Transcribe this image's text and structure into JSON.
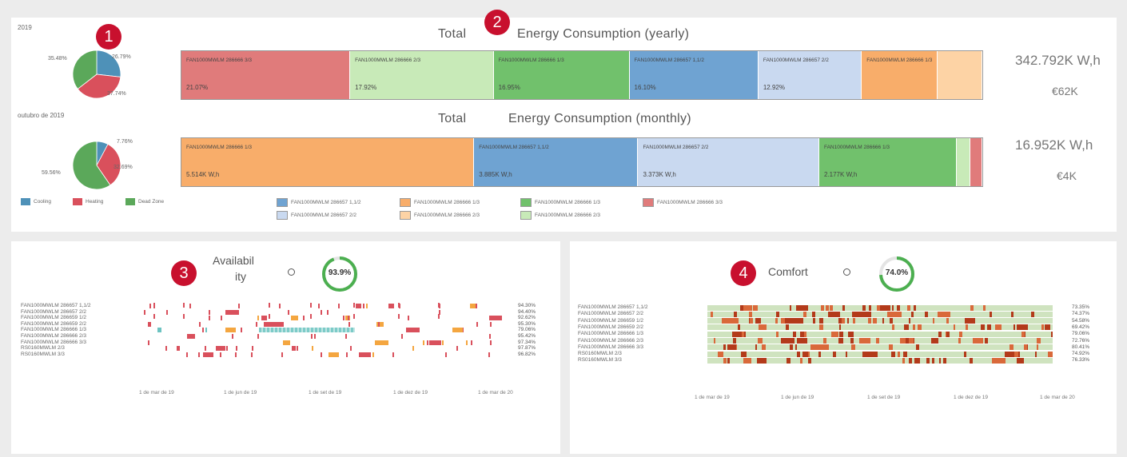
{
  "top": {
    "year_label": "2019",
    "month_label": "outubro de 2019",
    "yearly_title_a": "Total",
    "yearly_title_b": "Energy Consumption (yearly)",
    "monthly_title_a": "Total",
    "monthly_title_b": "Energy Consumption (monthly)",
    "yearly_total": "342.792K W,h",
    "yearly_cost": "€62K",
    "monthly_total": "16.952K W,h",
    "monthly_cost": "€4K",
    "yearly_pie": {
      "labels": [
        "35.48%",
        "26.79%",
        "37.74%"
      ],
      "slices": [
        {
          "name": "Cooling",
          "value": 26.79
        },
        {
          "name": "Heating",
          "value": 37.74
        },
        {
          "name": "Dead Zone",
          "value": 35.48
        }
      ]
    },
    "monthly_pie": {
      "labels": [
        "7.76%",
        "32.69%",
        "59.56%"
      ],
      "slices": [
        {
          "name": "Cooling",
          "value": 7.76
        },
        {
          "name": "Heating",
          "value": 32.69
        },
        {
          "name": "Dead Zone",
          "value": 59.56
        }
      ]
    },
    "yearly_bar": [
      {
        "label": "FAN1000MWLM 286666 3/3",
        "pct": "21.07%",
        "value": 21.07,
        "color": "#e07b7b"
      },
      {
        "label": "FAN1000MWLM 286666 2/3",
        "pct": "17.92%",
        "value": 17.92,
        "color": "#c8eab8"
      },
      {
        "label": "FAN1000MWLM 286666 1/3",
        "pct": "16.95%",
        "value": 16.95,
        "color": "#71c16c"
      },
      {
        "label": "FAN1000MWLM 286657 1,1/2",
        "pct": "16.10%",
        "value": 16.1,
        "color": "#6fa3d2"
      },
      {
        "label": "FAN1000MWLM 286657 2/2",
        "pct": "12.92%",
        "value": 12.92,
        "color": "#c9d9f0"
      },
      {
        "label": "FAN1000MWLM 286666 1/3",
        "pct": "",
        "value": 9.5,
        "color": "#f8ad6a"
      },
      {
        "label": "",
        "pct": "",
        "value": 5.54,
        "color": "#fdd3a5"
      }
    ],
    "monthly_bar": [
      {
        "label": "FAN1000MWLM 286666 1/3",
        "pct": "5.514K W,h",
        "value": 32.5,
        "color": "#f8ad6a"
      },
      {
        "label": "FAN1000MWLM 286657 1,1/2",
        "pct": "3.885K W,h",
        "value": 18.2,
        "color": "#6fa3d2"
      },
      {
        "label": "FAN1000MWLM 286657 2/2",
        "pct": "3.373K W,h",
        "value": 20.1,
        "color": "#c9d9f0"
      },
      {
        "label": "FAN1000MWLM 286666 1/3",
        "pct": "2.177K W,h",
        "value": 15.3,
        "color": "#71c16c"
      },
      {
        "label": "",
        "pct": "",
        "value": 1.5,
        "color": "#c8eab8"
      },
      {
        "label": "",
        "pct": "",
        "value": 1.3,
        "color": "#e07b7b"
      }
    ],
    "pie_legend": [
      {
        "label": "Cooling",
        "color": "#4e91b8"
      },
      {
        "label": "Heating",
        "color": "#d9505c"
      },
      {
        "label": "Dead Zone",
        "color": "#5ba85a"
      }
    ],
    "bar_legend": [
      {
        "label": "FAN1000MWLM 286657 1,1/2",
        "color": "#6fa3d2"
      },
      {
        "label": "FAN1000MWLM 286666 1/3",
        "color": "#f8ad6a"
      },
      {
        "label": "FAN1000MWLM 286666 1/3",
        "color": "#71c16c"
      },
      {
        "label": "FAN1000MWLM 286666 3/3",
        "color": "#e07b7b"
      },
      {
        "label": "FAN1000MWLM 286657 2/2",
        "color": "#c9d9f0"
      },
      {
        "label": "FAN1000MWLM 286666 2/3",
        "color": "#fdd3a5"
      },
      {
        "label": "FAN1000MWLM 286666 2/3",
        "color": "#c8eab8"
      }
    ]
  },
  "badges": [
    "1",
    "2",
    "3",
    "4"
  ],
  "availability": {
    "title_line1": "Availabil",
    "title_line2": "ity",
    "info_icon": "info-icon",
    "gauge_value": "93.9%",
    "gauge_fraction": 0.939,
    "rows": [
      {
        "name": "FAN1000MWLM 286657 1,1/2",
        "value": "94.30%"
      },
      {
        "name": "FAN1000MWLM 286657 2/2",
        "value": "94.40%"
      },
      {
        "name": "FAN1000MWLM 286659 1/2",
        "value": "92.62%"
      },
      {
        "name": "FAN1000MWLM 286659 2/2",
        "value": "95.30%"
      },
      {
        "name": "FAN1000MWLM 286666 1/3",
        "value": "79.06%"
      },
      {
        "name": "FAN1000MWLM 286666 2/3",
        "value": "95.42%"
      },
      {
        "name": "FAN1000MWLM 286666 3/3",
        "value": "97.34%"
      },
      {
        "name": "RS0160MWLM 2/3",
        "value": "97.87%"
      },
      {
        "name": "RS0160MWLM 3/3",
        "value": "96.82%"
      }
    ],
    "ticks": [
      "1 de mar de 19",
      "1 de jun de 19",
      "1 de set de 19",
      "1 de dez de 19",
      "1 de mar de 20"
    ]
  },
  "comfort": {
    "title": "Comfort",
    "info_icon": "info-icon",
    "gauge_value": "74.0%",
    "gauge_fraction": 0.74,
    "rows": [
      {
        "name": "FAN1000MWLM 286657 1,1/2",
        "value": "73.35%"
      },
      {
        "name": "FAN1000MWLM 286657 2/2",
        "value": "74.37%"
      },
      {
        "name": "FAN1000MWLM 286659 1/2",
        "value": "54.58%"
      },
      {
        "name": "FAN1000MWLM 286659 2/2",
        "value": "69.42%"
      },
      {
        "name": "FAN1000MWLM 286666 1/3",
        "value": "79.06%"
      },
      {
        "name": "FAN1000MWLM 286666 2/3",
        "value": "72.76%"
      },
      {
        "name": "FAN1000MWLM 286666 3/3",
        "value": "80.41%"
      },
      {
        "name": "RS0160MWLM 2/3",
        "value": "74.92%"
      },
      {
        "name": "RS0160MWLM 3/3",
        "value": "76.33%"
      }
    ],
    "ticks": [
      "1 de mar de 19",
      "1 de jun de 19",
      "1 de set de 19",
      "1 de dez de 19",
      "1 de mar de 20"
    ]
  },
  "colors": {
    "badge": "#c8102e",
    "gauge": "#4caf50",
    "comfort_bg": "#cfe3bf",
    "comfort_dark": "#b33a1a",
    "comfort_mid": "#d9693a"
  }
}
